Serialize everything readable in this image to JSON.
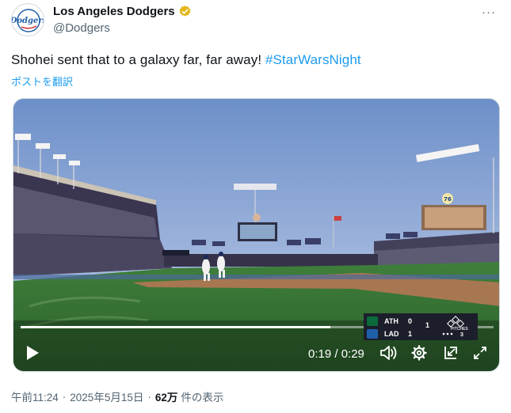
{
  "header": {
    "display_name": "Los Angeles Dodgers",
    "handle": "@Dodgers",
    "avatar_text": "Dodgers",
    "more_glyph": "···"
  },
  "tweet": {
    "text": "Shohei sent that to a galaxy far, far away! ",
    "hashtag": "#StarWarsNight",
    "translate_label": "ポストを翻訳"
  },
  "video": {
    "time_display": "0:19 / 0:29",
    "progress_fraction": 0.6552,
    "scene_sign": "76",
    "scorebug": {
      "away": {
        "abbr": "ATH",
        "score": "0",
        "color": "#0b6b3a"
      },
      "home": {
        "abbr": "LAD",
        "score": "1",
        "color": "#1f5fa8"
      },
      "inning": "1",
      "pitches_label": "PITCHES",
      "pitches": "3"
    }
  },
  "footer": {
    "time": "午前11:24",
    "date": "2025年5月15日",
    "views": "62万",
    "views_suffix": "件の表示"
  },
  "colors": {
    "accent": "#1d9bf0",
    "secondary_text": "#536471",
    "verified_badge": "#e2b719"
  }
}
